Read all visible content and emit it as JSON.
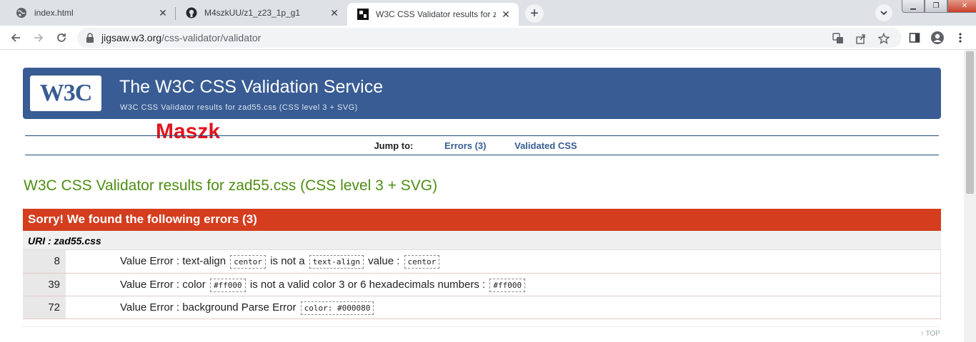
{
  "browser": {
    "tabs": [
      {
        "title": "index.html",
        "icon": "globe-icon"
      },
      {
        "title": "M4szkUU/z1_z23_1p_g1",
        "icon": "github-icon"
      },
      {
        "title": "W3C CSS Validator results for zad",
        "icon": "w3c-icon"
      }
    ],
    "url_host": "jigsaw.w3.org",
    "url_path": "/css-validator/validator"
  },
  "banner": {
    "logo": "W3C",
    "title": "The W3C CSS Validation Service",
    "subtitle": "W3C CSS Validator results for zad55.css (CSS level 3 + SVG)"
  },
  "overlay_label": "Maszk",
  "jump": {
    "label": "Jump to:",
    "errors_link": "Errors (3)",
    "validated_link": "Validated CSS"
  },
  "results_title": "W3C CSS Validator results for zad55.css (CSS level 3 + SVG)",
  "errors": {
    "heading": "Sorry! We found the following errors (3)",
    "uri": "URI : zad55.css",
    "rows": [
      {
        "line": "8",
        "p1": "Value Error : text-align",
        "c1": "centor",
        "p2": "is not a",
        "c2": "text-align",
        "p3": "value :",
        "c3": "centor"
      },
      {
        "line": "39",
        "p1": "Value Error : color",
        "c1": "#ff000",
        "p2": "is not a valid color 3 or 6 hexadecimals numbers :",
        "c2": "#ff000"
      },
      {
        "line": "72",
        "p1": "Value Error : background Parse Error",
        "c1": "color: #000080"
      }
    ]
  },
  "to_top": "↑ TOP",
  "colors": {
    "banner": "#385c93",
    "error_header": "#d43d1e",
    "results_title": "#4e8d13",
    "overlay": "#e0141e"
  }
}
